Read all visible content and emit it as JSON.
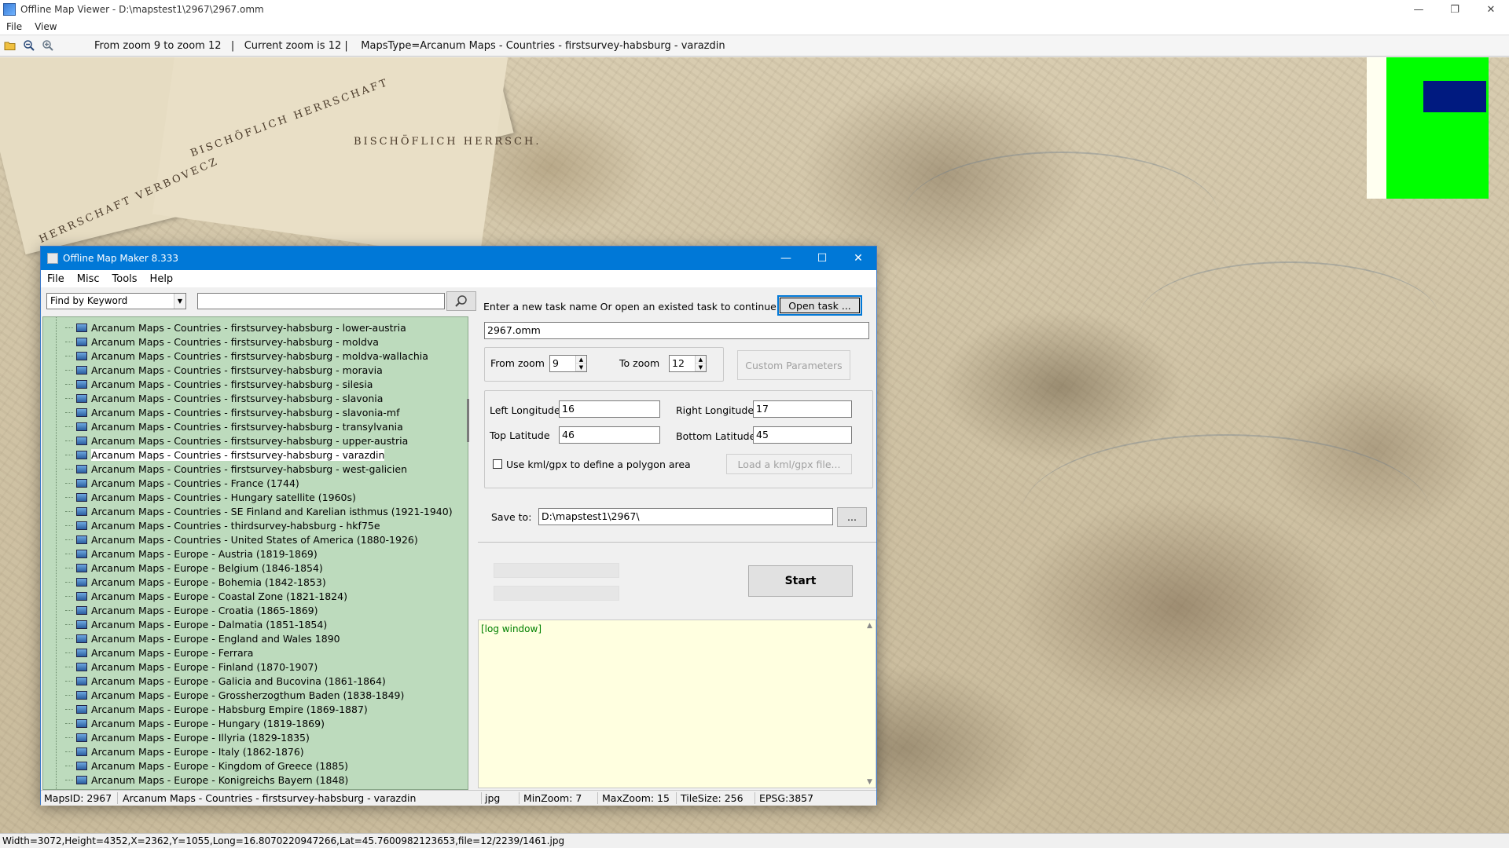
{
  "viewer": {
    "title": "Offline Map Viewer - D:\\mapstest1\\2967\\2967.omm",
    "menu": [
      "File",
      "View"
    ],
    "toolbar_info": "From zoom 9 to zoom 12   |   Current zoom is 12 |    MapsType=Arcanum Maps - Countries - firstsurvey-habsburg - varazdin",
    "toolbar_icons": [
      "open-folder-icon",
      "zoom-out-icon",
      "zoom-in-icon"
    ],
    "status": "Width=3072,Height=4352,X=2362,Y=1055,Long=16.8070220947266,Lat=45.7600982123653,file=12/2239/1461.jpg",
    "map_labels": [
      "HERRSCHAFT VERBOVECZ",
      "BISCHÖFLICH HERRSCHAFT",
      "BISCHÖFLICH HERRSCH."
    ],
    "overview_colors": {
      "background": "#fffff0",
      "coverage": "#00ff00",
      "viewport": "#001a80"
    }
  },
  "maker": {
    "title": "Offline Map Maker 8.333",
    "menu": [
      "File",
      "Misc",
      "Tools",
      "Help"
    ],
    "search": {
      "mode": "Find by Keyword",
      "query": ""
    },
    "tree_items": [
      "Arcanum Maps - Countries - firstsurvey-habsburg - lower-austria",
      "Arcanum Maps - Countries - firstsurvey-habsburg - moldva",
      "Arcanum Maps - Countries - firstsurvey-habsburg - moldva-wallachia",
      "Arcanum Maps - Countries - firstsurvey-habsburg - moravia",
      "Arcanum Maps - Countries - firstsurvey-habsburg - silesia",
      "Arcanum Maps - Countries - firstsurvey-habsburg - slavonia",
      "Arcanum Maps - Countries - firstsurvey-habsburg - slavonia-mf",
      "Arcanum Maps - Countries - firstsurvey-habsburg - transylvania",
      "Arcanum Maps - Countries - firstsurvey-habsburg - upper-austria",
      "Arcanum Maps - Countries - firstsurvey-habsburg - varazdin",
      "Arcanum Maps - Countries - firstsurvey-habsburg - west-galicien",
      "Arcanum Maps - Countries - France (1744)",
      "Arcanum Maps - Countries - Hungary satellite (1960s)",
      "Arcanum Maps - Countries - SE Finland and Karelian isthmus (1921-1940)",
      "Arcanum Maps - Countries - thirdsurvey-habsburg - hkf75e",
      "Arcanum Maps - Countries - United States of America (1880-1926)",
      "Arcanum Maps - Europe - Austria (1819-1869)",
      "Arcanum Maps - Europe - Belgium (1846-1854)",
      "Arcanum Maps - Europe - Bohemia (1842-1853)",
      "Arcanum Maps - Europe - Coastal Zone (1821-1824)",
      "Arcanum Maps - Europe - Croatia (1865-1869)",
      "Arcanum Maps - Europe - Dalmatia (1851-1854)",
      "Arcanum Maps - Europe - England and Wales 1890",
      "Arcanum Maps - Europe - Ferrara",
      "Arcanum Maps - Europe - Finland (1870-1907)",
      "Arcanum Maps - Europe - Galicia and Bucovina (1861-1864)",
      "Arcanum Maps - Europe - Grossherzogthum Baden (1838-1849)",
      "Arcanum Maps - Europe - Habsburg Empire (1869-1887)",
      "Arcanum Maps - Europe - Hungary (1819-1869)",
      "Arcanum Maps - Europe - Illyria (1829-1835)",
      "Arcanum Maps - Europe - Italy (1862-1876)",
      "Arcanum Maps - Europe - Kingdom of Greece (1885)",
      "Arcanum Maps - Europe - Konigreichs Bayern (1848)"
    ],
    "selected_index": 9,
    "task_prompt": "Enter a new task name Or open an existed task to continue:",
    "open_task_label": "Open task ...",
    "task_name": "2967.omm",
    "from_zoom_label": "From zoom",
    "from_zoom": "9",
    "to_zoom_label": "To zoom",
    "to_zoom": "12",
    "custom_params_label": "Custom Parameters",
    "left_lon_label": "Left Longitude",
    "left_lon": "16",
    "right_lon_label": "Right Longitude",
    "right_lon": "17",
    "top_lat_label": "Top Latitude",
    "top_lat": "46",
    "bottom_lat_label": "Bottom Latitude",
    "bottom_lat": "45",
    "kml_label": "Use kml/gpx to define a polygon area",
    "kml_btn_label": "Load a kml/gpx file...",
    "save_to_label": "Save to:",
    "save_to": "D:\\mapstest1\\2967\\",
    "browse_label": "...",
    "start_label": "Start",
    "log_text": "[log window]",
    "status": {
      "maps_id": "MapsID: 2967",
      "map_name": "Arcanum Maps - Countries - firstsurvey-habsburg - varazdin",
      "format": "jpg",
      "min_zoom": "MinZoom: 7",
      "max_zoom": "MaxZoom: 15",
      "tile_size": "TileSize: 256",
      "epsg": "EPSG:3857"
    }
  }
}
